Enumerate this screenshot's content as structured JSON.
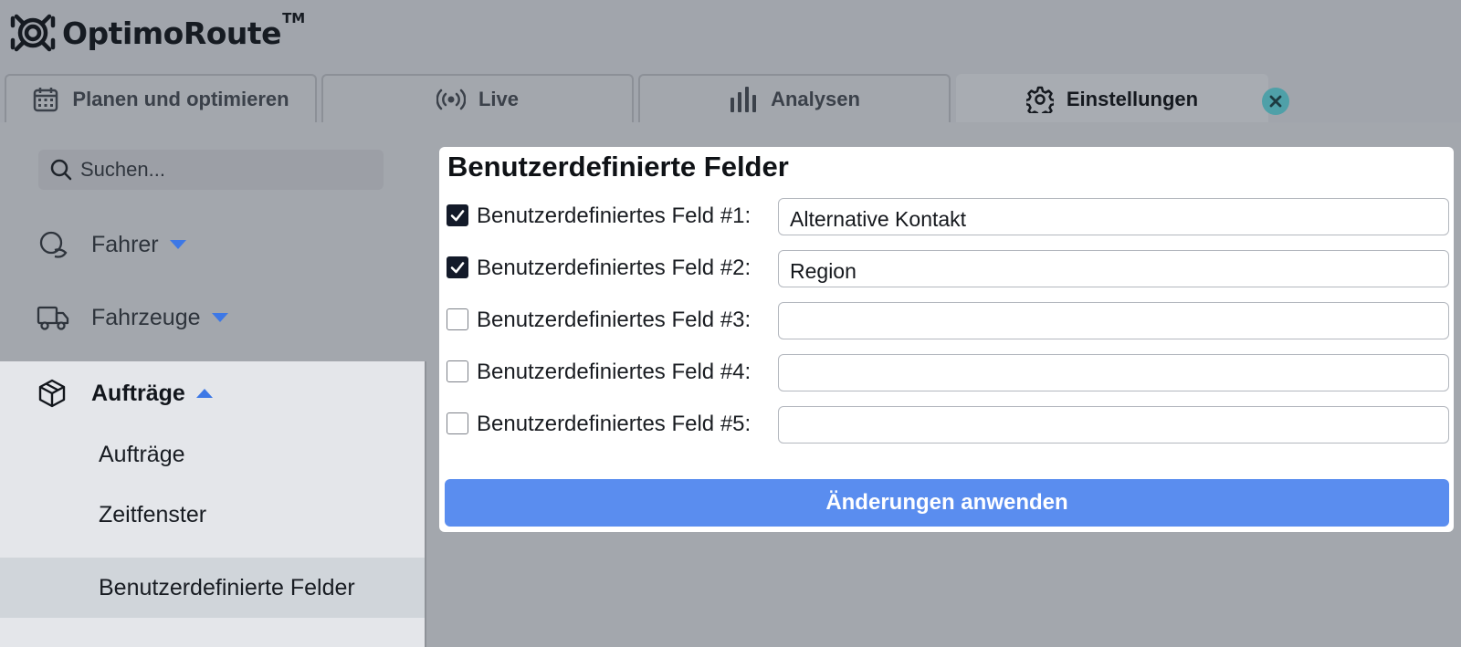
{
  "app": {
    "name": "OptimoRoute",
    "trademark": "TM"
  },
  "tabs": [
    {
      "label": "Planen und optimieren",
      "icon": "calendar-icon"
    },
    {
      "label": "Live",
      "icon": "broadcast-icon"
    },
    {
      "label": "Analysen",
      "icon": "bar-chart-icon"
    },
    {
      "label": "Einstellungen",
      "icon": "gear-icon",
      "active": true
    }
  ],
  "sidebar": {
    "search_placeholder": "Suchen...",
    "items": [
      {
        "label": "Fahrer",
        "icon": "driver-icon",
        "expanded": false
      },
      {
        "label": "Fahrzeuge",
        "icon": "truck-icon",
        "expanded": false
      },
      {
        "label": "Aufträge",
        "icon": "package-icon",
        "expanded": true
      }
    ],
    "subitems": [
      {
        "label": "Aufträge"
      },
      {
        "label": "Zeitfenster"
      },
      {
        "label": "Benutzerdefinierte Felder",
        "selected": true
      }
    ]
  },
  "panel": {
    "title": "Benutzerdefinierte Felder",
    "fields": [
      {
        "label": "Benutzerdefiniertes Feld #1:",
        "checked": true,
        "value": "Alternative Kontakt"
      },
      {
        "label": "Benutzerdefiniertes Feld #2:",
        "checked": true,
        "value": "Region"
      },
      {
        "label": "Benutzerdefiniertes Feld #3:",
        "checked": false,
        "value": ""
      },
      {
        "label": "Benutzerdefiniertes Feld #4:",
        "checked": false,
        "value": ""
      },
      {
        "label": "Benutzerdefiniertes Feld #5:",
        "checked": false,
        "value": ""
      }
    ],
    "apply_label": "Änderungen anwenden"
  },
  "colors": {
    "accent": "#5a8def",
    "caret": "#3d78e6",
    "close_badge": "#4fa0a8"
  }
}
